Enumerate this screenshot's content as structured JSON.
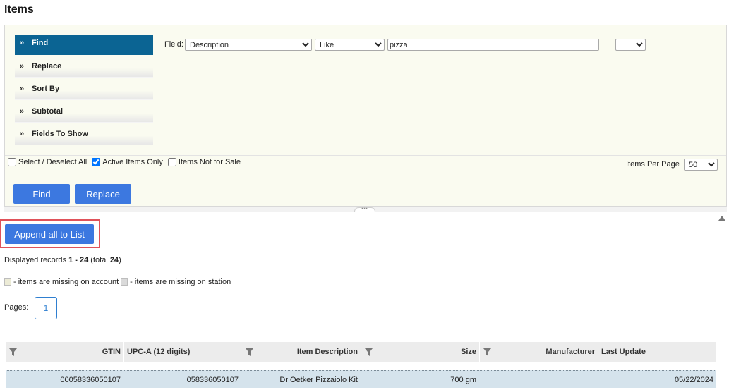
{
  "page": {
    "title": "Items"
  },
  "tabs": [
    {
      "label": "Find",
      "arrow": "»",
      "active": true
    },
    {
      "label": "Replace",
      "arrow": "»",
      "active": false
    },
    {
      "label": "Sort By",
      "arrow": "»",
      "active": false
    },
    {
      "label": "Subtotal",
      "arrow": "»",
      "active": false
    },
    {
      "label": "Fields To Show",
      "arrow": "»",
      "active": false
    }
  ],
  "find": {
    "field_label": "Field:",
    "field_value": "Description",
    "operator_value": "Like",
    "search_value": "pizza",
    "extra_value": ""
  },
  "options": {
    "select_all_label": "Select / Deselect All",
    "select_all_checked": false,
    "active_only_label": "Active Items Only",
    "active_only_checked": true,
    "not_for_sale_label": "Items Not for Sale",
    "not_for_sale_checked": false,
    "items_per_page_label": "Items Per Page",
    "items_per_page_value": "50"
  },
  "buttons": {
    "find": "Find",
    "replace": "Replace",
    "append_all": "Append all to List"
  },
  "records": {
    "prefix": "Displayed records ",
    "range": "1 - 24",
    "total_prefix": " (total ",
    "total": "24",
    "total_suffix": ")"
  },
  "legend": {
    "account": " - items are missing on account",
    "station": " - items are missing on station",
    "account_color": "#ecebd6",
    "station_color": "#dadada"
  },
  "pagination": {
    "label": "Pages:",
    "pages": [
      "1"
    ]
  },
  "table": {
    "columns": {
      "gtin": "GTIN",
      "upca": "UPC-A (12 digits)",
      "description": "Item Description",
      "size": "Size",
      "manufacturer": "Manufacturer",
      "last_update": "Last Update"
    },
    "rows": [
      {
        "gtin": "00058336050107",
        "upca": "058336050107",
        "description": "Dr Oetker Pizzaiolo Kit",
        "size": "700 gm",
        "manufacturer": "",
        "last_update": "05/22/2024"
      }
    ]
  },
  "colors": {
    "accent": "#3c78e0",
    "active_tab": "#0b6493",
    "highlight": "#e0525a",
    "row_bg": "#d5e3ec"
  },
  "icons": {
    "filter": "filter-icon",
    "tab_arrow": "double-chevron-right-icon",
    "scroll_up": "triangle-up-icon"
  }
}
